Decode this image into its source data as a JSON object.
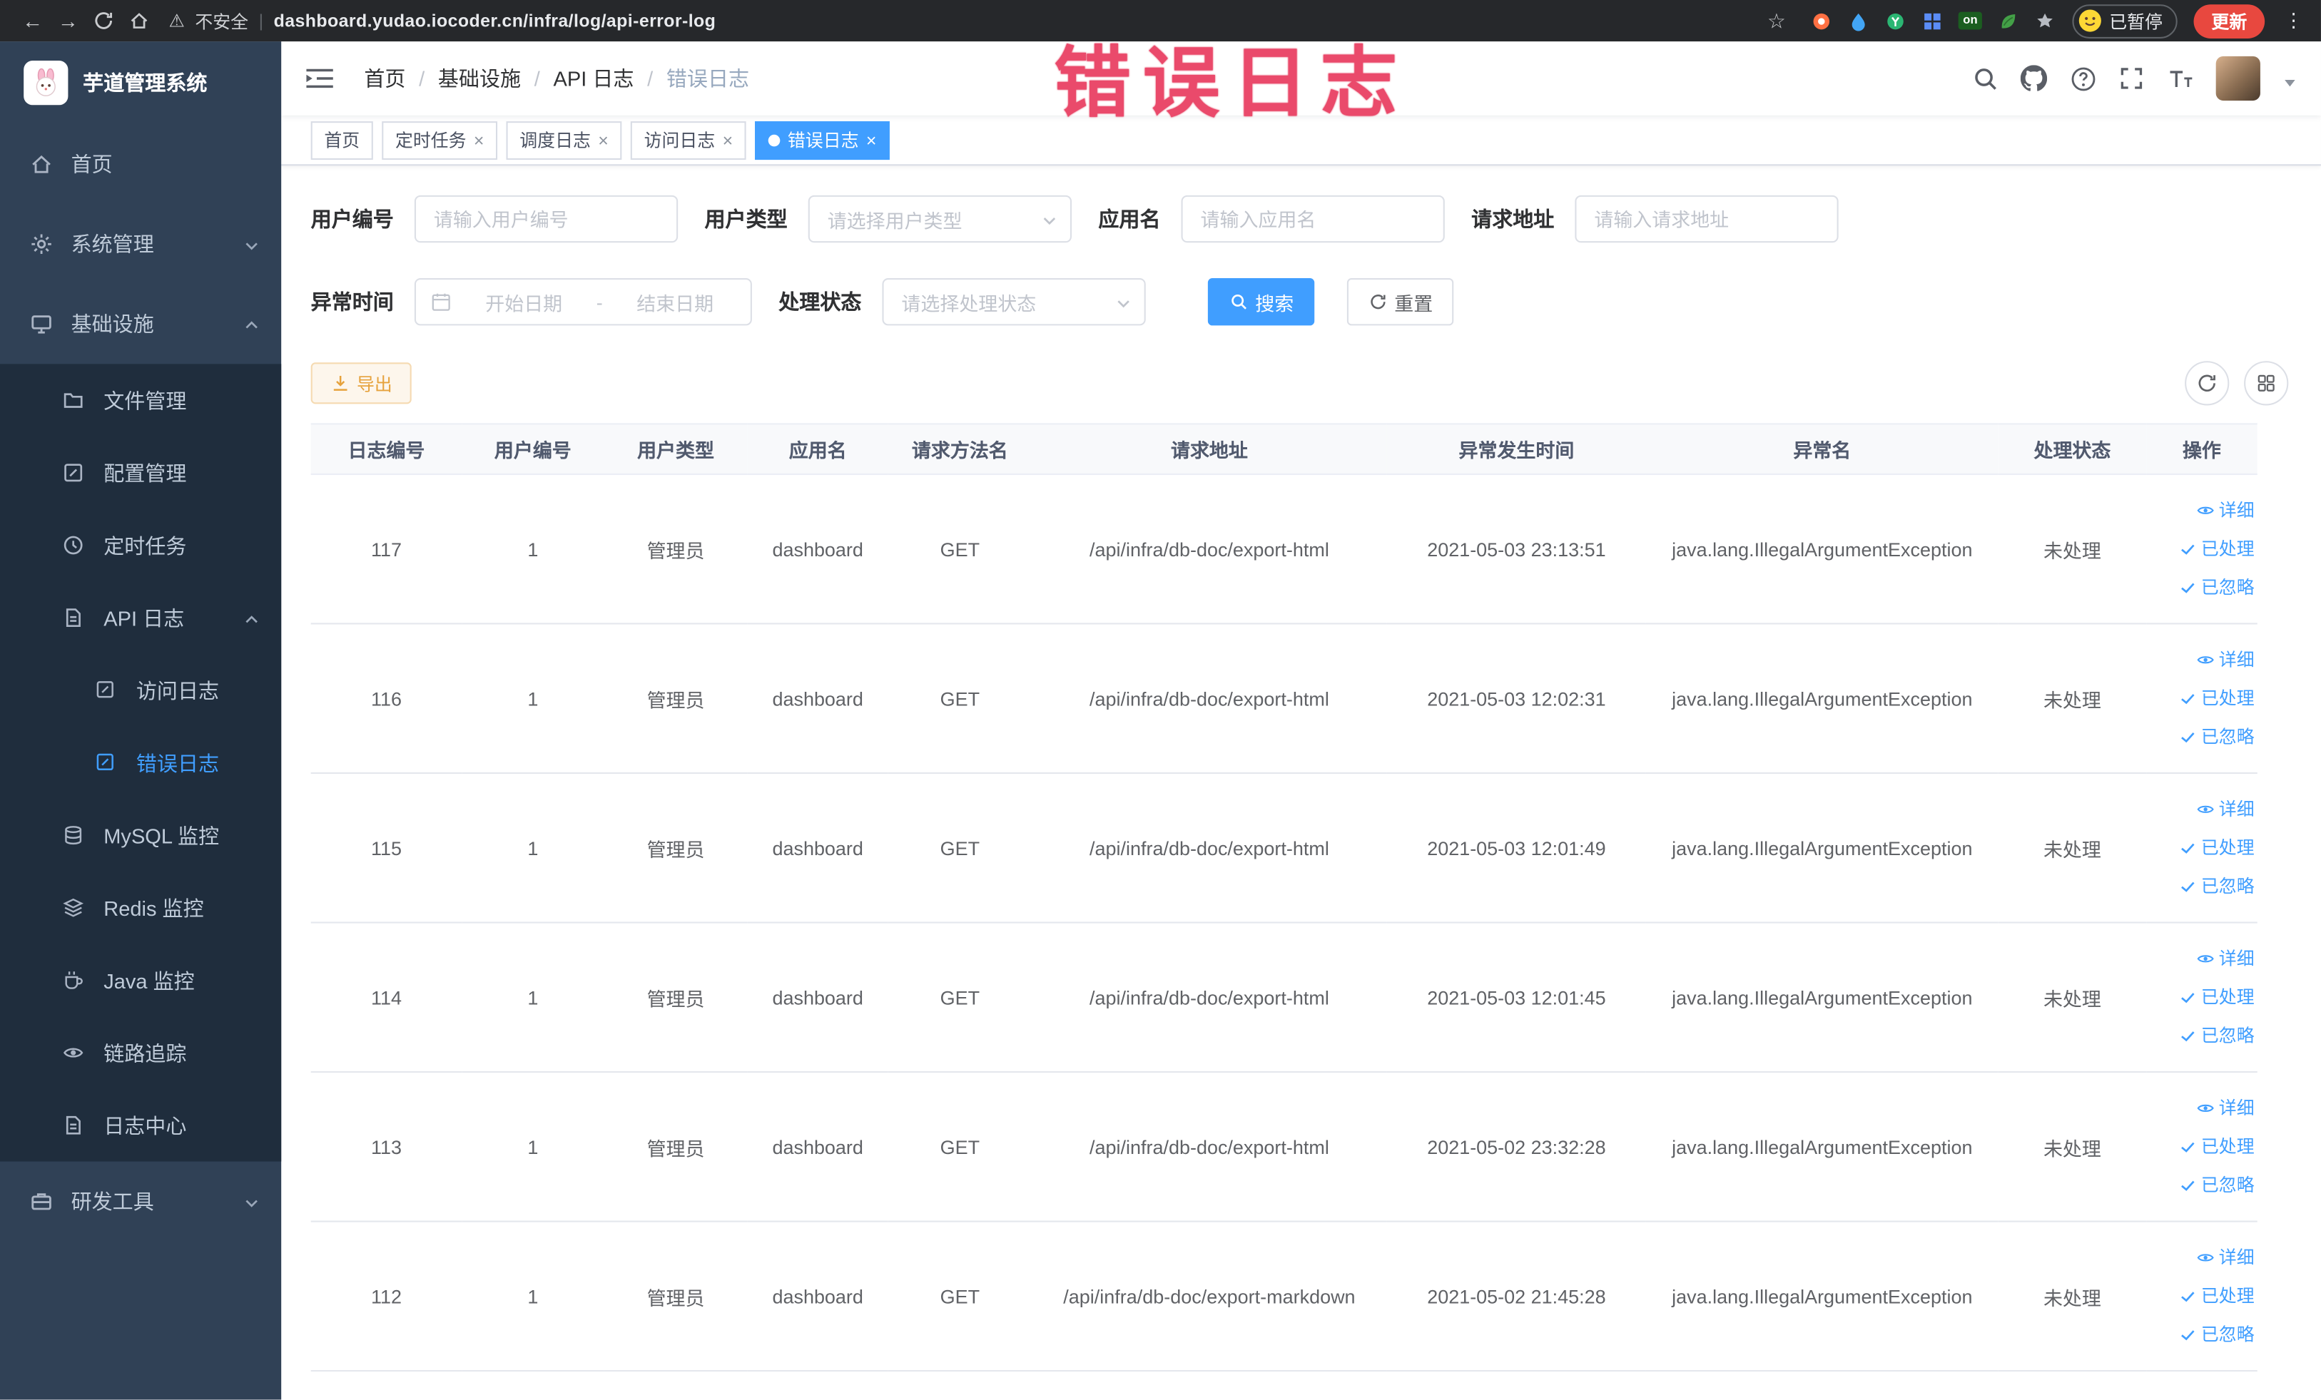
{
  "browser": {
    "security_label": "不安全",
    "url": "dashboard.yudao.iocoder.cn/infra/log/api-error-log",
    "paused_badge": "已暂停",
    "update_button": "更新",
    "extension_on_badge": "on"
  },
  "icons": {
    "back": "←",
    "forward": "→",
    "star": "☆",
    "warning": "⚠",
    "pipe": "|",
    "kebab": "⋮",
    "close": "×"
  },
  "annotation": "错误日志",
  "sidebar": {
    "logo_title": "芋道管理系统",
    "items": [
      {
        "label": "首页"
      },
      {
        "label": "系统管理"
      },
      {
        "label": "基础设施"
      },
      {
        "label": "文件管理"
      },
      {
        "label": "配置管理"
      },
      {
        "label": "定时任务"
      },
      {
        "label": "API 日志"
      },
      {
        "label": "访问日志"
      },
      {
        "label": "错误日志"
      },
      {
        "label": "MySQL 监控"
      },
      {
        "label": "Redis 监控"
      },
      {
        "label": "Java 监控"
      },
      {
        "label": "链路追踪"
      },
      {
        "label": "日志中心"
      },
      {
        "label": "研发工具"
      }
    ]
  },
  "breadcrumb": {
    "separator": "/",
    "items": [
      "首页",
      "基础设施",
      "API 日志",
      "错误日志"
    ]
  },
  "tabs": [
    {
      "label": "首页"
    },
    {
      "label": "定时任务"
    },
    {
      "label": "调度日志"
    },
    {
      "label": "访问日志"
    },
    {
      "label": "错误日志"
    }
  ],
  "filters": {
    "user_id_label": "用户编号",
    "user_id_placeholder": "请输入用户编号",
    "user_type_label": "用户类型",
    "user_type_placeholder": "请选择用户类型",
    "app_name_label": "应用名",
    "app_name_placeholder": "请输入应用名",
    "request_url_label": "请求地址",
    "request_url_placeholder": "请输入请求地址",
    "exception_time_label": "异常时间",
    "date_start_placeholder": "开始日期",
    "date_separator": "-",
    "date_end_placeholder": "结束日期",
    "process_status_label": "处理状态",
    "process_status_placeholder": "请选择处理状态",
    "search_button": "搜索",
    "reset_button": "重置"
  },
  "toolbar": {
    "export_button": "导出"
  },
  "table": {
    "headers": [
      "日志编号",
      "用户编号",
      "用户类型",
      "应用名",
      "请求方法名",
      "请求地址",
      "异常发生时间",
      "异常名",
      "处理状态",
      "操作"
    ],
    "action_labels": {
      "detail": "详细",
      "processed": "已处理",
      "ignore": "已忽略"
    },
    "rows": [
      {
        "id": "117",
        "user_id": "1",
        "user_type": "管理员",
        "app_name": "dashboard",
        "method": "GET",
        "url": "/api/infra/db-doc/export-html",
        "time": "2021-05-03 23:13:51",
        "exception": "java.lang.IllegalArgumentException",
        "status": "未处理"
      },
      {
        "id": "116",
        "user_id": "1",
        "user_type": "管理员",
        "app_name": "dashboard",
        "method": "GET",
        "url": "/api/infra/db-doc/export-html",
        "time": "2021-05-03 12:02:31",
        "exception": "java.lang.IllegalArgumentException",
        "status": "未处理"
      },
      {
        "id": "115",
        "user_id": "1",
        "user_type": "管理员",
        "app_name": "dashboard",
        "method": "GET",
        "url": "/api/infra/db-doc/export-html",
        "time": "2021-05-03 12:01:49",
        "exception": "java.lang.IllegalArgumentException",
        "status": "未处理"
      },
      {
        "id": "114",
        "user_id": "1",
        "user_type": "管理员",
        "app_name": "dashboard",
        "method": "GET",
        "url": "/api/infra/db-doc/export-html",
        "time": "2021-05-03 12:01:45",
        "exception": "java.lang.IllegalArgumentException",
        "status": "未处理"
      },
      {
        "id": "113",
        "user_id": "1",
        "user_type": "管理员",
        "app_name": "dashboard",
        "method": "GET",
        "url": "/api/infra/db-doc/export-html",
        "time": "2021-05-02 23:32:28",
        "exception": "java.lang.IllegalArgumentException",
        "status": "未处理"
      },
      {
        "id": "112",
        "user_id": "1",
        "user_type": "管理员",
        "app_name": "dashboard",
        "method": "GET",
        "url": "/api/infra/db-doc/export-markdown",
        "time": "2021-05-02 21:45:28",
        "exception": "java.lang.IllegalArgumentException",
        "status": "未处理"
      }
    ]
  }
}
